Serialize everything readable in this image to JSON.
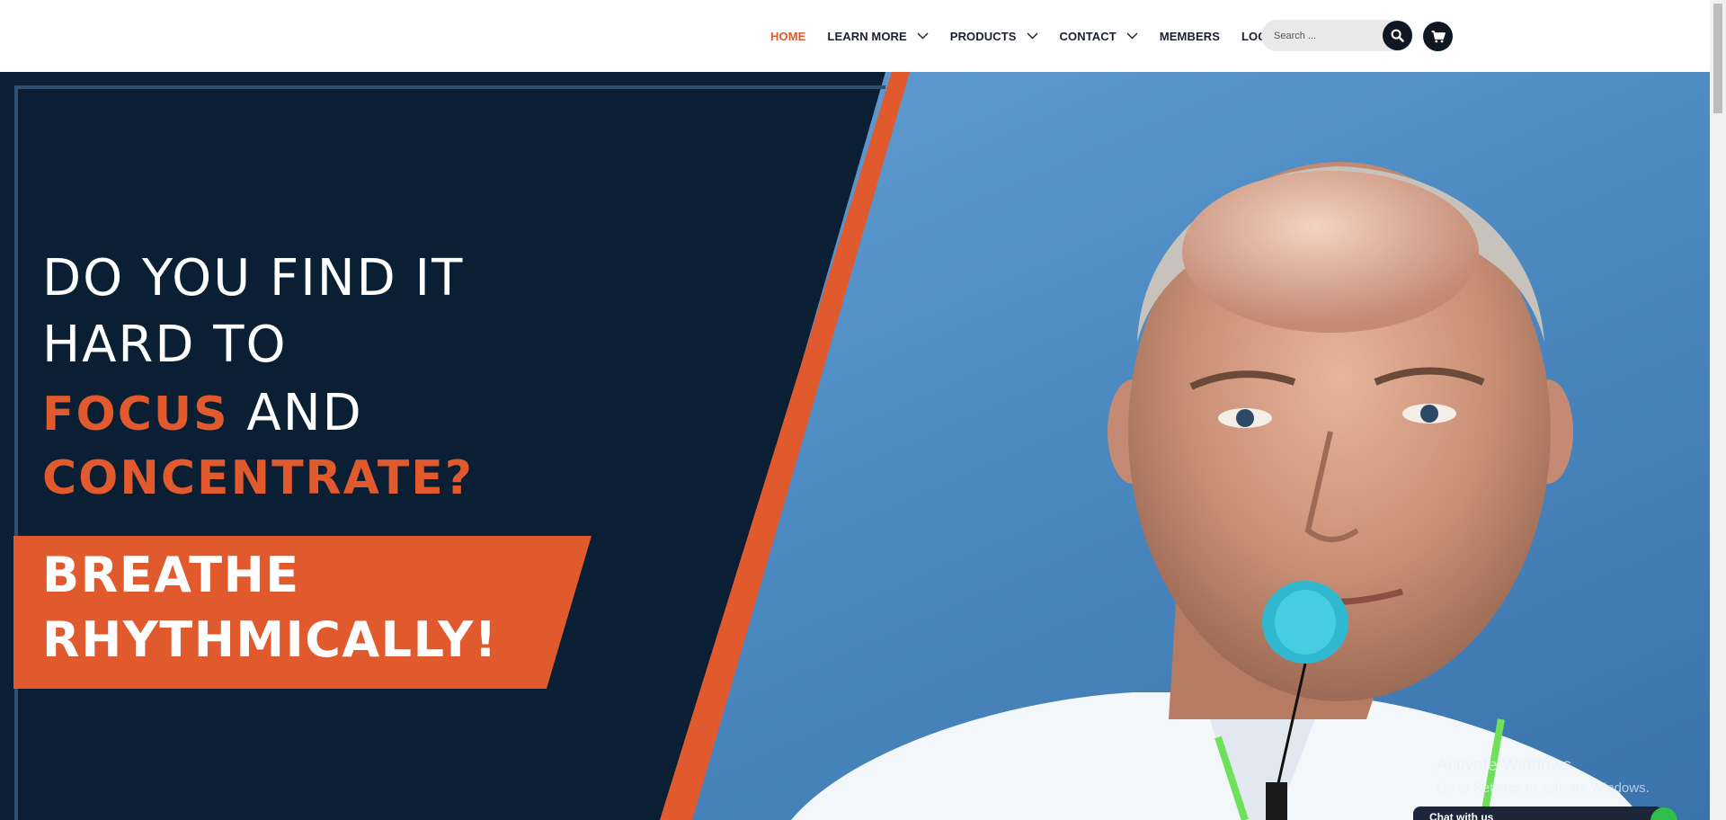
{
  "nav": {
    "items": [
      {
        "label": "HOME",
        "active": true,
        "has_dropdown": false
      },
      {
        "label": "LEARN MORE",
        "active": false,
        "has_dropdown": true
      },
      {
        "label": "PRODUCTS",
        "active": false,
        "has_dropdown": true
      },
      {
        "label": "CONTACT",
        "active": false,
        "has_dropdown": true
      },
      {
        "label": "MEMBERS",
        "active": false,
        "has_dropdown": false
      },
      {
        "label": "LOG IN",
        "active": false,
        "has_dropdown": false
      }
    ],
    "dropdown_icon": "chevron-down-icon"
  },
  "search": {
    "placeholder": "Search ...",
    "value": "",
    "button_icon": "search-icon"
  },
  "cart": {
    "icon": "cart-icon"
  },
  "hero": {
    "line1": "DO YOU FIND IT",
    "line2": "HARD TO",
    "line3_highlight": "FOCUS",
    "line3_rest": " AND",
    "line4": "CONCENTRATE?",
    "cta_line1": "BREATHE",
    "cta_line2": "RHYTHMICALLY!"
  },
  "system_overlay": {
    "watermark_title": "Activate Windows",
    "watermark_sub": "Go to Settings to activate Windows."
  },
  "chat": {
    "label": "Chat with us"
  },
  "colors": {
    "accent": "#e05a2e",
    "navy": "#0a1f33",
    "nav_text": "#1b1f2e",
    "button_dark": "#0f1722",
    "sky": "#5a98d0"
  }
}
